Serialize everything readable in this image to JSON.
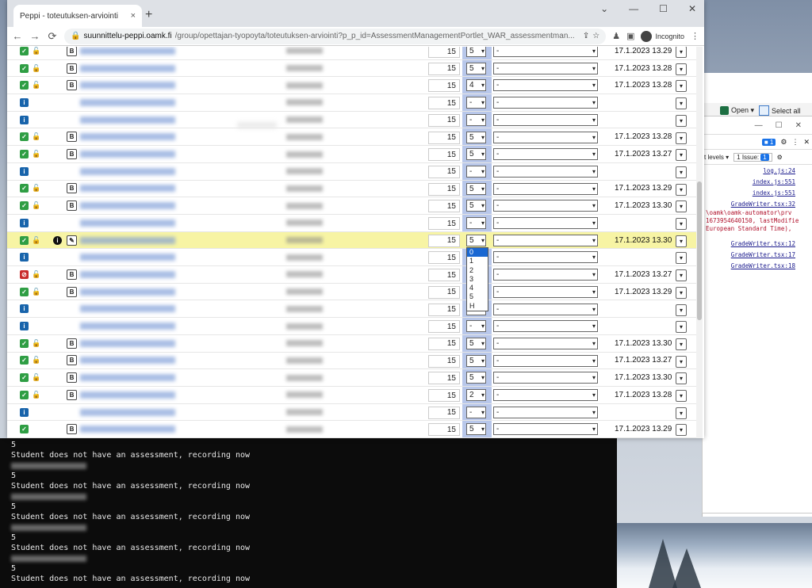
{
  "browser": {
    "tab_title": "Peppi - toteutuksen-arviointi",
    "tab_close": "×",
    "new_tab": "+",
    "window_controls": [
      "⌄",
      "—",
      "☐",
      "✕"
    ],
    "url_host": "suunnittelu-peppi.oamk.fi",
    "url_path": "/group/opettajan-tyopoyta/toteutuksen-arviointi?p_p_id=AssessmentManagementPortlet_WAR_assessmentman...",
    "profile_label": "Incognito",
    "nav": {
      "back": "←",
      "forward": "→",
      "reload": "⟳"
    }
  },
  "grade_options": [
    "0",
    "1",
    "2",
    "3",
    "4",
    "5",
    "H"
  ],
  "rows": [
    {
      "status": "green",
      "locked": true,
      "info": false,
      "pb": true,
      "pb_glyph": "B",
      "credits": "15",
      "grade": "5",
      "comment": "-",
      "date": "17.1.2023 13.29"
    },
    {
      "status": "green",
      "locked": true,
      "info": false,
      "pb": true,
      "pb_glyph": "B",
      "credits": "15",
      "grade": "5",
      "comment": "-",
      "date": "17.1.2023 13.28"
    },
    {
      "status": "green",
      "locked": true,
      "info": false,
      "pb": true,
      "pb_glyph": "B",
      "credits": "15",
      "grade": "4",
      "comment": "-",
      "date": "17.1.2023 13.28"
    },
    {
      "status": "blue",
      "locked": false,
      "info": false,
      "pb": false,
      "credits": "15",
      "grade": "-",
      "comment": "-",
      "date": ""
    },
    {
      "status": "blue",
      "locked": false,
      "info": false,
      "pb": false,
      "credits": "15",
      "grade": "-",
      "comment": "-",
      "date": ""
    },
    {
      "status": "green",
      "locked": true,
      "info": false,
      "pb": true,
      "pb_glyph": "B",
      "credits": "15",
      "grade": "5",
      "comment": "-",
      "date": "17.1.2023 13.28"
    },
    {
      "status": "green",
      "locked": true,
      "info": false,
      "pb": true,
      "pb_glyph": "B",
      "credits": "15",
      "grade": "5",
      "comment": "-",
      "date": "17.1.2023 13.27"
    },
    {
      "status": "blue",
      "locked": false,
      "info": false,
      "pb": false,
      "credits": "15",
      "grade": "-",
      "comment": "-",
      "date": ""
    },
    {
      "status": "green",
      "locked": true,
      "info": false,
      "pb": true,
      "pb_glyph": "B",
      "credits": "15",
      "grade": "5",
      "comment": "-",
      "date": "17.1.2023 13.29"
    },
    {
      "status": "green",
      "locked": true,
      "info": false,
      "pb": true,
      "pb_glyph": "B",
      "credits": "15",
      "grade": "5",
      "comment": "-",
      "date": "17.1.2023 13.30"
    },
    {
      "status": "blue",
      "locked": false,
      "info": false,
      "pb": false,
      "credits": "15",
      "grade": "-",
      "comment": "-",
      "date": ""
    },
    {
      "status": "green",
      "locked": true,
      "info": true,
      "pb": true,
      "pb_glyph": "✎",
      "credits": "15",
      "grade": "5",
      "comment": "-",
      "date": "17.1.2023 13.30",
      "highlight": true
    },
    {
      "status": "blue",
      "locked": false,
      "info": false,
      "pb": false,
      "credits": "15",
      "grade": "-",
      "comment": "-",
      "date": ""
    },
    {
      "status": "red",
      "locked": true,
      "info": false,
      "pb": true,
      "pb_glyph": "B",
      "credits": "15",
      "grade": "5",
      "comment": "-",
      "date": "17.1.2023 13.27"
    },
    {
      "status": "green",
      "locked": true,
      "info": false,
      "pb": true,
      "pb_glyph": "B",
      "credits": "15",
      "grade": "5",
      "comment": "-",
      "date": "17.1.2023 13.29"
    },
    {
      "status": "blue",
      "locked": false,
      "info": false,
      "pb": false,
      "credits": "15",
      "grade": "-",
      "comment": "-",
      "date": ""
    },
    {
      "status": "blue",
      "locked": false,
      "info": false,
      "pb": false,
      "credits": "15",
      "grade": "-",
      "comment": "-",
      "date": ""
    },
    {
      "status": "green",
      "locked": true,
      "info": false,
      "pb": true,
      "pb_glyph": "B",
      "credits": "15",
      "grade": "5",
      "comment": "-",
      "date": "17.1.2023 13.30"
    },
    {
      "status": "green",
      "locked": true,
      "info": false,
      "pb": true,
      "pb_glyph": "B",
      "credits": "15",
      "grade": "5",
      "comment": "-",
      "date": "17.1.2023 13.27"
    },
    {
      "status": "green",
      "locked": true,
      "info": false,
      "pb": true,
      "pb_glyph": "B",
      "credits": "15",
      "grade": "5",
      "comment": "-",
      "date": "17.1.2023 13.30"
    },
    {
      "status": "green",
      "locked": true,
      "info": false,
      "pb": true,
      "pb_glyph": "B",
      "credits": "15",
      "grade": "2",
      "comment": "-",
      "date": "17.1.2023 13.28"
    },
    {
      "status": "blue",
      "locked": false,
      "info": false,
      "pb": false,
      "credits": "15",
      "grade": "-",
      "comment": "-",
      "date": ""
    },
    {
      "status": "green",
      "locked": false,
      "info": false,
      "pb": true,
      "pb_glyph": "B",
      "credits": "15",
      "grade": "5",
      "comment": "-",
      "date": "17.1.2023 13.29"
    }
  ],
  "open_dropdown_row": 11,
  "excel": {
    "open_label": "Open ▾",
    "select_all_label": "Select all"
  },
  "devtools": {
    "window_controls": [
      "—",
      "☐",
      "✕"
    ],
    "messages_count": "1",
    "levels_label": "t levels ▾",
    "issues_label": "1 Issue:",
    "issues_count": "1",
    "links": [
      "log.js:24",
      "index.js:551",
      "index.js:551",
      "GradeWriter.tsx:32"
    ],
    "error_lines": [
      "\\oamk\\oamk-automator\\prv",
      "1673954640150, lastModifie",
      "European Standard Time),"
    ],
    "links2": [
      "GradeWriter.tsx:12",
      "GradeWriter.tsx:17",
      "GradeWriter.tsx:18"
    ]
  },
  "terminal": {
    "lines": [
      {
        "kind": "text",
        "text": "5"
      },
      {
        "kind": "text",
        "text": "Student does not have an assessment, recording now"
      },
      {
        "kind": "blur"
      },
      {
        "kind": "text",
        "text": "5"
      },
      {
        "kind": "text",
        "text": "Student does not have an assessment, recording now"
      },
      {
        "kind": "blur"
      },
      {
        "kind": "text",
        "text": "5"
      },
      {
        "kind": "text",
        "text": "Student does not have an assessment, recording now"
      },
      {
        "kind": "blur"
      },
      {
        "kind": "text",
        "text": "5"
      },
      {
        "kind": "text",
        "text": "Student does not have an assessment, recording now"
      },
      {
        "kind": "blur"
      },
      {
        "kind": "text",
        "text": "5"
      },
      {
        "kind": "text",
        "text": "Student does not have an assessment, recording now"
      }
    ]
  },
  "colors": {
    "highlight_row": "#f7f4a4",
    "grade_column": "#b8c7ea",
    "status_green": "#2f9e44",
    "status_red": "#c92a2a",
    "status_blue": "#1864ab"
  }
}
